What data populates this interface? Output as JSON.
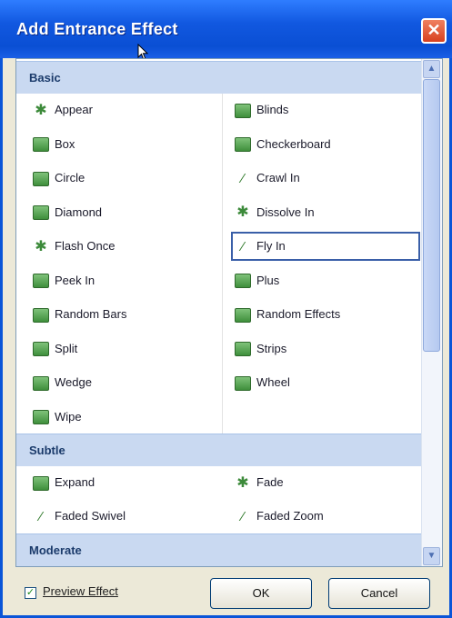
{
  "window": {
    "title": "Add Entrance Effect",
    "close_glyph": "✕"
  },
  "sections": {
    "basic": "Basic",
    "subtle": "Subtle",
    "moderate": "Moderate"
  },
  "basic_left": [
    {
      "label": "Appear",
      "icon": "star-icon"
    },
    {
      "label": "Box",
      "icon": "effect-icon"
    },
    {
      "label": "Circle",
      "icon": "effect-icon"
    },
    {
      "label": "Diamond",
      "icon": "effect-icon"
    },
    {
      "label": "Flash Once",
      "icon": "star-icon"
    },
    {
      "label": "Peek In",
      "icon": "effect-icon"
    },
    {
      "label": "Random Bars",
      "icon": "effect-icon"
    },
    {
      "label": "Split",
      "icon": "effect-icon"
    },
    {
      "label": "Wedge",
      "icon": "effect-icon"
    },
    {
      "label": "Wipe",
      "icon": "effect-icon"
    }
  ],
  "basic_right": [
    {
      "label": "Blinds",
      "icon": "effect-icon"
    },
    {
      "label": "Checkerboard",
      "icon": "effect-icon"
    },
    {
      "label": "Crawl In",
      "icon": "wand-icon"
    },
    {
      "label": "Dissolve In",
      "icon": "star-icon"
    },
    {
      "label": "Fly In",
      "icon": "wand-icon"
    },
    {
      "label": "Plus",
      "icon": "effect-icon"
    },
    {
      "label": "Random Effects",
      "icon": "effect-icon"
    },
    {
      "label": "Strips",
      "icon": "effect-icon"
    },
    {
      "label": "Wheel",
      "icon": "effect-icon"
    }
  ],
  "subtle_left": [
    {
      "label": "Expand",
      "icon": "effect-icon"
    },
    {
      "label": "Faded Swivel",
      "icon": "wand-icon"
    }
  ],
  "subtle_right": [
    {
      "label": "Fade",
      "icon": "star-icon"
    },
    {
      "label": "Faded Zoom",
      "icon": "wand-icon"
    }
  ],
  "selected_item": "Fly In",
  "footer": {
    "preview_label": "Preview Effect",
    "preview_checked": true,
    "ok_label": "OK",
    "cancel_label": "Cancel"
  },
  "scrollbar": {
    "up_glyph": "▲",
    "down_glyph": "▼"
  },
  "colors": {
    "titlebar": "#0a4fd4",
    "section_header": "#c9d9f1",
    "dialog_bg": "#ece9d8"
  }
}
